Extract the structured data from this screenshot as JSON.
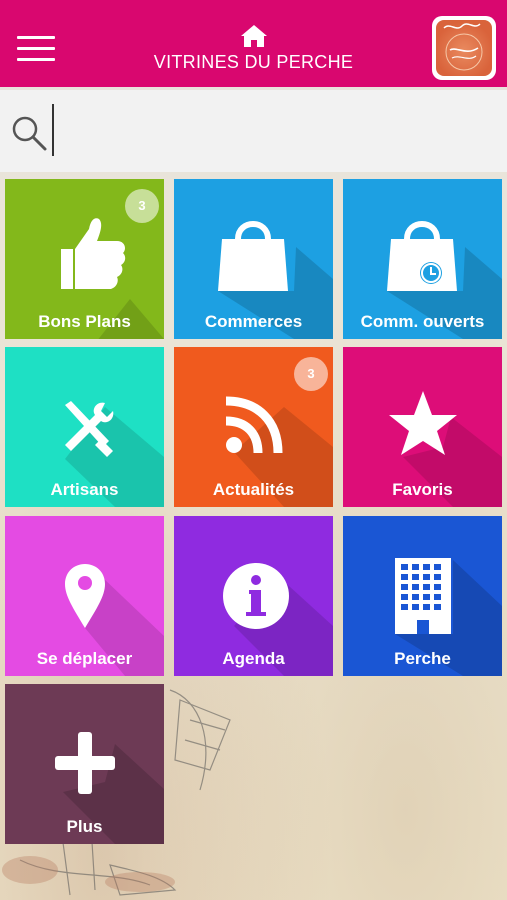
{
  "header": {
    "title": "VITRINES DU PERCHE",
    "menu_icon": "hamburger-menu-icon",
    "home_icon": "home-icon",
    "logo_text": "Les Vitrines du Perche",
    "background_color": "#d9076f"
  },
  "search": {
    "placeholder": "",
    "value": ""
  },
  "tiles": [
    {
      "label": "Bons Plans",
      "icon": "thumbs-up-icon",
      "color": "#83b81b",
      "badge": "3"
    },
    {
      "label": "Commerces",
      "icon": "shopping-bag-icon",
      "color": "#1da0e2",
      "badge": ""
    },
    {
      "label": "Comm. ouverts",
      "icon": "shopping-bag-clock-icon",
      "color": "#1da0e2",
      "badge": ""
    },
    {
      "label": "Artisans",
      "icon": "tools-icon",
      "color": "#1ee0c4",
      "badge": ""
    },
    {
      "label": "Actualités",
      "icon": "rss-icon",
      "color": "#f05a1e",
      "badge": "3"
    },
    {
      "label": "Favoris",
      "icon": "star-icon",
      "color": "#dd0d78",
      "badge": ""
    },
    {
      "label": "Se déplacer",
      "icon": "map-pin-icon",
      "color": "#e44be3",
      "badge": ""
    },
    {
      "label": "Agenda",
      "icon": "info-icon",
      "color": "#8f2be0",
      "badge": ""
    },
    {
      "label": "Perche",
      "icon": "building-icon",
      "color": "#1a56d4",
      "badge": ""
    },
    {
      "label": "Plus",
      "icon": "plus-icon",
      "color": "#6d3a55",
      "badge": ""
    }
  ]
}
